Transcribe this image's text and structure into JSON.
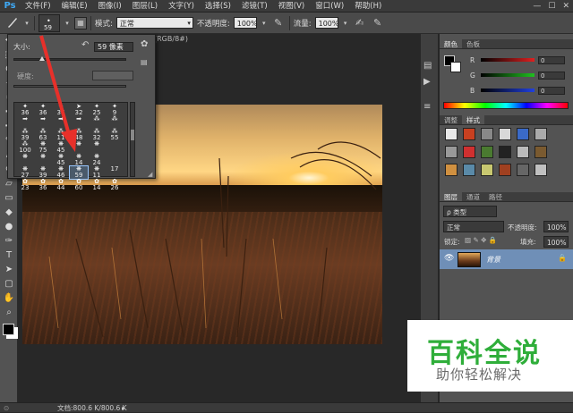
{
  "app": {
    "logo": "Ps"
  },
  "menubar": {
    "items": [
      "文件(F)",
      "编辑(E)",
      "图像(I)",
      "图层(L)",
      "文字(Y)",
      "选择(S)",
      "滤镜(T)",
      "视图(V)",
      "窗口(W)",
      "帮助(H)"
    ],
    "window_controls": [
      "—",
      "☐",
      "✕"
    ]
  },
  "options_bar": {
    "brush_size": "59",
    "mode_label": "模式:",
    "mode_value": "正常",
    "opacity_label": "不透明度:",
    "opacity_value": "100%",
    "flow_label": "流量:",
    "flow_value": "100%"
  },
  "doc_tab": {
    "title": "(RGB/8#)"
  },
  "brush_picker": {
    "size_label": "大小:",
    "size_value": "59 像素",
    "hardness_label": "硬度:",
    "size_level": 0.25,
    "presets": [
      {
        "n": "36",
        "g": "✦"
      },
      {
        "n": "36",
        "g": "✦"
      },
      {
        "n": "36",
        "g": "✦"
      },
      {
        "n": "32",
        "g": "➤"
      },
      {
        "n": "25",
        "g": "✦"
      },
      {
        "n": "9",
        "g": "✦"
      },
      {
        "n": "➡",
        "g": ""
      },
      {
        "n": "➡",
        "g": ""
      },
      {
        "n": "➡",
        "g": ""
      },
      {
        "n": "➡",
        "g": ""
      },
      {
        "n": "",
        "g": "⁂"
      },
      {
        "n": "",
        "g": "⁂"
      },
      {
        "n": "39",
        "g": "⁂"
      },
      {
        "n": "63",
        "g": "⁂"
      },
      {
        "n": "11",
        "g": "⁂"
      },
      {
        "n": "48",
        "g": "⁂"
      },
      {
        "n": "32",
        "g": "⁂"
      },
      {
        "n": "55",
        "g": "⁂"
      },
      {
        "n": "100",
        "g": "⁂"
      },
      {
        "n": "75",
        "g": "❋"
      },
      {
        "n": "45",
        "g": "❋"
      },
      {
        "n": "",
        "g": "❋"
      },
      {
        "n": "",
        "g": "❋"
      },
      {
        "n": "",
        "g": ""
      },
      {
        "n": "",
        "g": "❋"
      },
      {
        "n": "",
        "g": "❋"
      },
      {
        "n": "45",
        "g": "❋"
      },
      {
        "n": "14",
        "g": "❋"
      },
      {
        "n": "24",
        "g": "❋"
      },
      {
        "n": "",
        "g": ""
      },
      {
        "n": "27",
        "g": "❋"
      },
      {
        "n": "39",
        "g": "❋"
      },
      {
        "n": "46",
        "g": "❋"
      },
      {
        "n": "59",
        "g": "❋"
      },
      {
        "n": "11",
        "g": "❋"
      },
      {
        "n": "17",
        "g": ""
      },
      {
        "n": "23",
        "g": "✿"
      },
      {
        "n": "36",
        "g": "✿"
      },
      {
        "n": "44",
        "g": "✿"
      },
      {
        "n": "60",
        "g": "✿"
      },
      {
        "n": "14",
        "g": "✿"
      },
      {
        "n": "26",
        "g": "✿"
      }
    ],
    "selected_index": 33
  },
  "color_panel": {
    "tabs": [
      "颜色",
      "色板"
    ],
    "rows": [
      {
        "label": "R",
        "value": "0",
        "color": "#e02020"
      },
      {
        "label": "G",
        "value": "0",
        "color": "#20c020"
      },
      {
        "label": "B",
        "value": "0",
        "color": "#2040e0"
      }
    ]
  },
  "adjust_panel": {
    "tabs": [
      "调整",
      "样式"
    ]
  },
  "layers_panel": {
    "tabs": [
      "图层",
      "通道",
      "路径"
    ],
    "filter_label": "ρ 类型",
    "blend_mode": "正常",
    "opacity_label": "不透明度:",
    "opacity_value": "100%",
    "lock_label": "锁定:",
    "fill_label": "填充:",
    "fill_value": "100%",
    "layer_name": "背景"
  },
  "watermark": {
    "title": "百科全说",
    "subtitle": "助你轻松解决"
  },
  "status_bar": {
    "zoom": "",
    "doc_info": "文档:800.6 K/800.6 K"
  }
}
